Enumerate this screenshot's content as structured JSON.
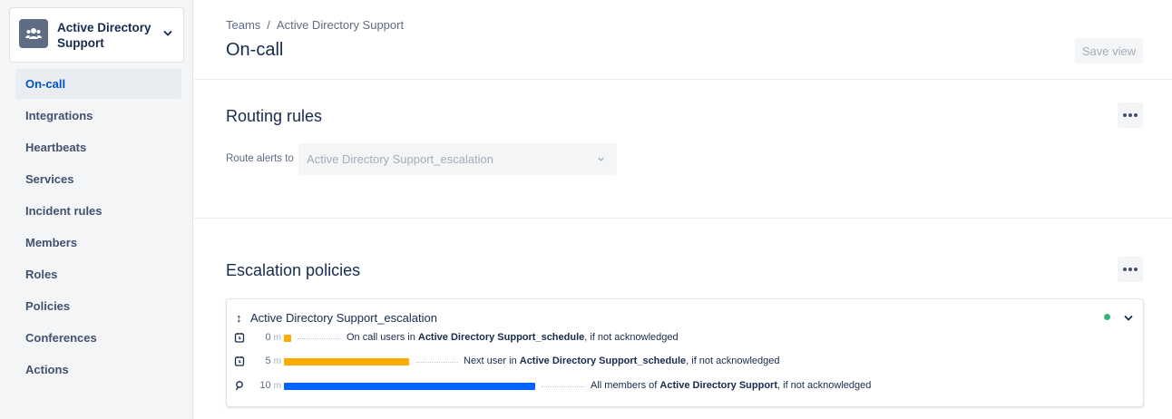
{
  "sidebar": {
    "team_name": "Active Directory Support",
    "items": [
      {
        "label": "On-call",
        "active": true
      },
      {
        "label": "Integrations"
      },
      {
        "label": "Heartbeats"
      },
      {
        "label": "Services"
      },
      {
        "label": "Incident rules"
      },
      {
        "label": "Members"
      },
      {
        "label": "Roles"
      },
      {
        "label": "Policies"
      },
      {
        "label": "Conferences"
      },
      {
        "label": "Actions"
      }
    ]
  },
  "header": {
    "breadcrumb": [
      "Teams",
      "/",
      "Active Directory Support"
    ],
    "title": "On-call",
    "save_view_label": "Save view"
  },
  "routing": {
    "title": "Routing rules",
    "route_label": "Route alerts to",
    "route_value": "Active Directory Support_escalation"
  },
  "escalation": {
    "title": "Escalation policies",
    "policy_name": "Active Directory Support_escalation",
    "status_color": "#36b37e",
    "rules": [
      {
        "icon": "schedule-icon",
        "time": "0",
        "unit": "m",
        "color": "#ffab00",
        "prefix": "On call users in ",
        "target": "Active Directory Support_schedule",
        "suffix": ", if not acknowledged"
      },
      {
        "icon": "schedule-icon",
        "time": "5",
        "unit": "m",
        "color": "#ffab00",
        "prefix": "Next user in ",
        "target": "Active Directory Support_schedule",
        "suffix": ", if not acknowledged"
      },
      {
        "icon": "team-icon",
        "time": "10",
        "unit": "m",
        "color": "#0065ff",
        "prefix": "All members of ",
        "target": "Active Directory Support",
        "suffix": ", if not acknowledged"
      }
    ]
  },
  "colors": {
    "accent": "#0052cc",
    "sidebar_bg": "#f4f5f7"
  }
}
